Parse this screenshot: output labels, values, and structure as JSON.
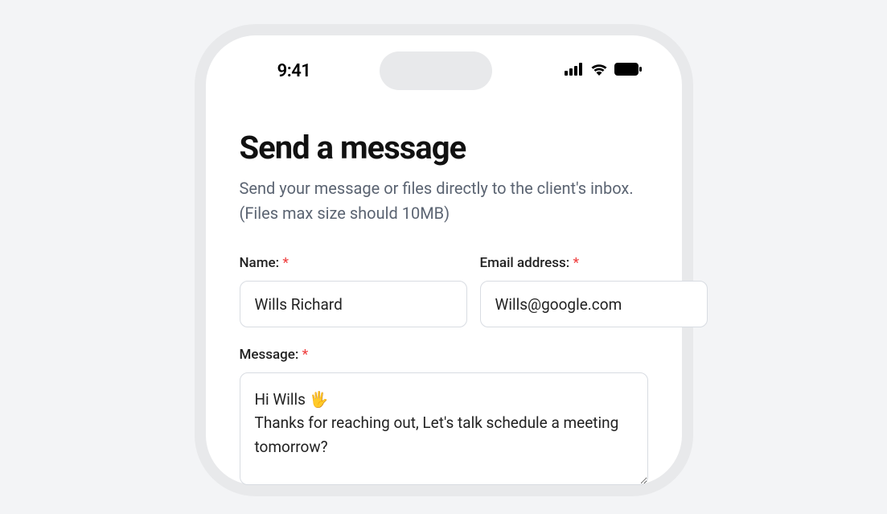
{
  "statusbar": {
    "time": "9:41"
  },
  "page": {
    "title": "Send a message",
    "subtitle": "Send your message or files directly to the client's inbox. (Files max size should 10MB)"
  },
  "form": {
    "name": {
      "label": "Name:",
      "value": "Wills Richard"
    },
    "email": {
      "label": "Email address:",
      "value": "Wills@google.com"
    },
    "message": {
      "label": "Message:",
      "value": "Hi Wills 🖐\nThanks for reaching out, Let's talk schedule a meeting tomorrow?"
    },
    "required_marker": "*"
  }
}
